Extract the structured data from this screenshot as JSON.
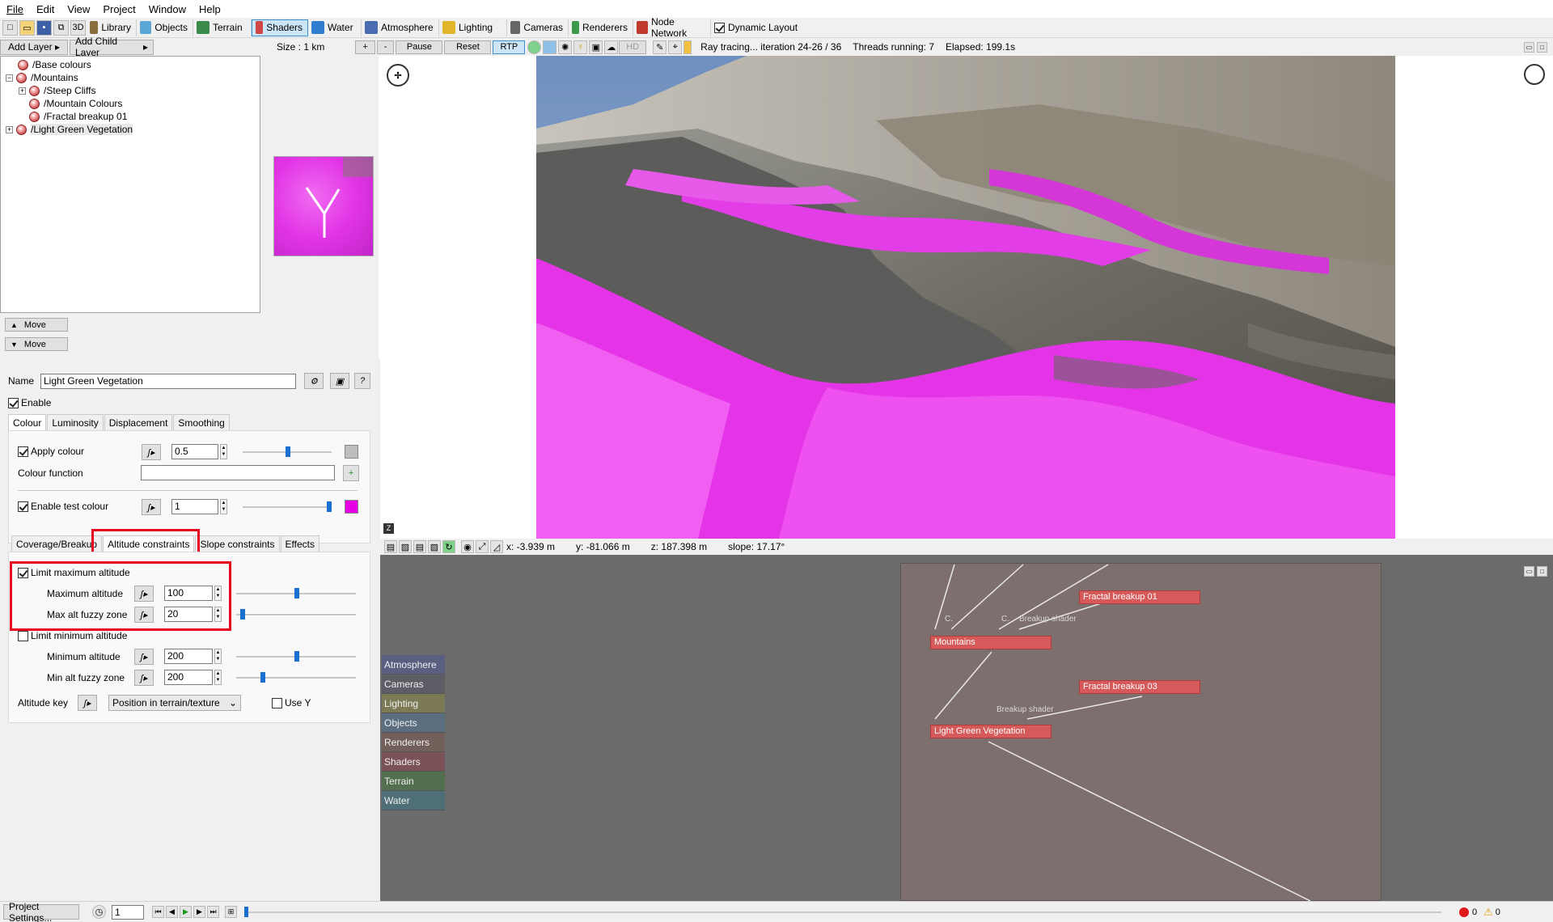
{
  "menu": [
    "File",
    "Edit",
    "View",
    "Project",
    "Window",
    "Help"
  ],
  "toolbar": {
    "tabs": [
      {
        "label": "Library",
        "icon": "library-icon",
        "color": "#8a6d3b"
      },
      {
        "label": "Objects",
        "icon": "objects-icon",
        "color": "#5aa7d6"
      },
      {
        "label": "Terrain",
        "icon": "terrain-icon",
        "color": "#3c8a4a"
      },
      {
        "label": "Shaders",
        "icon": "shaders-icon",
        "color": "#d04545"
      },
      {
        "label": "Water",
        "icon": "water-icon",
        "color": "#2f7dd1"
      },
      {
        "label": "Atmosphere",
        "icon": "atmosphere-icon",
        "color": "#4a6cb0"
      },
      {
        "label": "Lighting",
        "icon": "lighting-icon",
        "color": "#e0b52a"
      },
      {
        "label": "Cameras",
        "icon": "cameras-icon",
        "color": "#666666"
      },
      {
        "label": "Renderers",
        "icon": "renderers-icon",
        "color": "#3a9a4a"
      },
      {
        "label": "Node Network",
        "icon": "node-network-icon",
        "color": "#c0392b"
      }
    ],
    "dynamic_layout": "Dynamic Layout"
  },
  "layers": {
    "add_layer": "Add Layer",
    "add_child_layer": "Add Child Layer",
    "tree": [
      {
        "label": "/Base colours",
        "depth": 1,
        "expander": ""
      },
      {
        "label": "/Mountains",
        "depth": 0,
        "expander": "−"
      },
      {
        "label": "/Steep Cliffs",
        "depth": 2,
        "expander": "+"
      },
      {
        "label": "/Mountain Colours",
        "depth": 2,
        "expander": ""
      },
      {
        "label": "/Fractal breakup 01",
        "depth": 2,
        "expander": ""
      },
      {
        "label": "/Light Green Vegetation",
        "depth": 0,
        "expander": "+"
      }
    ],
    "move_up": "Move",
    "move_down": "Move"
  },
  "viewbar": {
    "size": "Size : 1 km",
    "plus": "+",
    "minus": "-",
    "pause": "Pause",
    "reset": "Reset",
    "rtp": "RTP",
    "hd": "HD",
    "status": "Ray tracing... iteration 24-26 / 36",
    "threads": "Threads running: 7",
    "elapsed": "Elapsed: 199.1s"
  },
  "coords": {
    "x": "x: -3.939 m",
    "y": "y: -81.066 m",
    "z": "z: 187.398 m",
    "slope": "slope: 17.17°"
  },
  "props": {
    "name_label": "Name",
    "name_value": "Light Green Vegetation",
    "enable_label": "Enable",
    "top_tabs": [
      "Colour",
      "Luminosity",
      "Displacement",
      "Smoothing"
    ],
    "apply_colour": "Apply colour",
    "apply_colour_value": "0.5",
    "colour_function": "Colour function",
    "enable_test_colour": "Enable test colour",
    "test_colour_value": "1",
    "test_colour": "#e600e6",
    "bottom_tabs": [
      "Coverage/Breakup",
      "Altitude constraints",
      "Slope constraints",
      "Effects"
    ],
    "limit_max": "Limit maximum altitude",
    "max_alt_label": "Maximum altitude",
    "max_alt_value": "100",
    "max_fuzzy_label": "Max alt fuzzy zone",
    "max_fuzzy_value": "20",
    "limit_min": "Limit minimum altitude",
    "min_alt_label": "Minimum altitude",
    "min_alt_value": "200",
    "min_fuzzy_label": "Min alt fuzzy zone",
    "min_fuzzy_value": "200",
    "altitude_key": "Altitude key",
    "altitude_key_value": "Position in terrain/texture",
    "use_y": "Use Y",
    "highlight": "#e8001c"
  },
  "nodes": {
    "categories": [
      {
        "label": "Atmosphere",
        "color": "#5a5f82"
      },
      {
        "label": "Cameras",
        "color": "#5d5d66"
      },
      {
        "label": "Lighting",
        "color": "#7b7a55"
      },
      {
        "label": "Objects",
        "color": "#5b6e80"
      },
      {
        "label": "Renderers",
        "color": "#735f5a"
      },
      {
        "label": "Shaders",
        "color": "#7a5257"
      },
      {
        "label": "Terrain",
        "color": "#52704f"
      },
      {
        "label": "Water",
        "color": "#4f6f78"
      }
    ],
    "fractal01": "Fractal breakup 01",
    "mountains": "Mountains",
    "fractal03": "Fractal breakup 03",
    "light_green": "Light Green Vegetation",
    "port_c1": "C.",
    "port_c2": "C.",
    "breakup1": "Breakup shader",
    "breakup2": "Breakup shader"
  },
  "status": {
    "project_settings": "Project Settings...",
    "frame": "1",
    "errors": "0",
    "warnings": "0"
  }
}
